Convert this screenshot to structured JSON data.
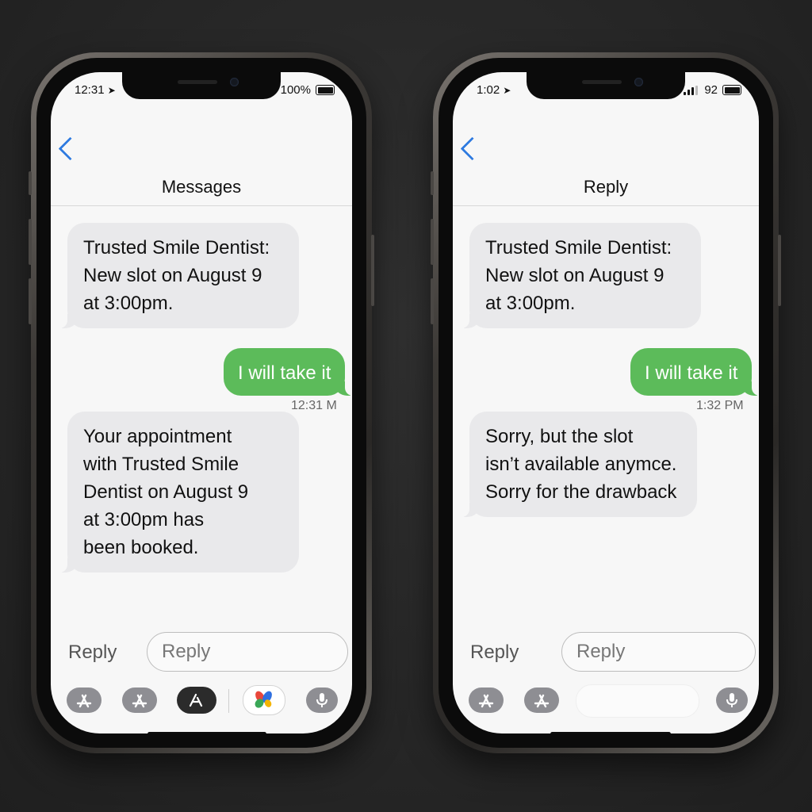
{
  "left_phone": {
    "status": {
      "time": "12:31",
      "battery": "100%"
    },
    "nav_title": "Messages",
    "messages": [
      {
        "type": "received",
        "text": "Trusted Smile Dentist:\nNew slot on August 9\nat 3:00pm."
      },
      {
        "type": "sent",
        "text": "I will take it",
        "timestamp": "12:31 M"
      },
      {
        "type": "received",
        "text": "Your appointment\nwith Trusted Smile\nDentist on August 9\nat 3:00pm has\nbeen booked."
      }
    ],
    "reply_label": "Reply",
    "reply_placeholder": "Reply",
    "app_tray": [
      "app-store-icon",
      "app-store-icon",
      "app-store-icon-dark",
      "photos-icon",
      "microphone-icon"
    ]
  },
  "right_phone": {
    "status": {
      "time": "1:02",
      "battery": "92"
    },
    "nav_title": "Reply",
    "messages": [
      {
        "type": "received",
        "text": "Trusted Smile Dentist:\nNew slot on August 9\nat 3:00pm."
      },
      {
        "type": "sent",
        "text": "I will take it",
        "timestamp": "1:32 PM"
      },
      {
        "type": "received",
        "text": "Sorry, but the slot\nisn’t available anymce.\nSorry for the drawback"
      }
    ],
    "reply_label": "Reply",
    "reply_placeholder": "Reply",
    "app_tray": [
      "app-store-icon",
      "app-store-icon",
      "microphone-icon"
    ]
  },
  "colors": {
    "sent_bubble": "#5cbb5a",
    "received_bubble": "#e9e9eb",
    "accent_blue": "#2f7be0",
    "background": "#262626"
  }
}
